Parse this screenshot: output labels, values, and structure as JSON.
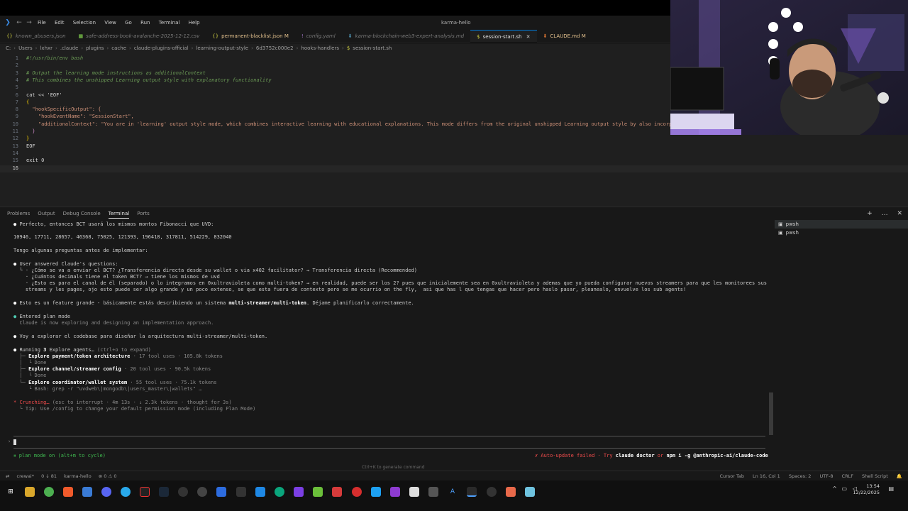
{
  "window": {
    "title": "karma-hello"
  },
  "menu": [
    "File",
    "Edit",
    "Selection",
    "View",
    "Go",
    "Run",
    "Terminal",
    "Help"
  ],
  "tabs": [
    {
      "label": "known_abusers.json",
      "icon": "json-icon",
      "state": "normal"
    },
    {
      "label": "safe-address-book-avalanche-2025-12-12.csv",
      "icon": "csv-icon",
      "state": "normal"
    },
    {
      "label": "permanent-blacklist.json M",
      "icon": "json-icon",
      "state": "modified"
    },
    {
      "label": "config.yaml",
      "icon": "yaml-icon",
      "state": "normal"
    },
    {
      "label": "karma-blockchain-web3-expert-analysis.md",
      "icon": "markdown-icon",
      "state": "normal"
    },
    {
      "label": "session-start.sh",
      "icon": "shell-icon",
      "state": "active"
    },
    {
      "label": "CLAUDE.md M",
      "icon": "markdown-icon",
      "state": "modified"
    }
  ],
  "breadcrumb": [
    "C:",
    "Users",
    "lxhxr",
    ".claude",
    "plugins",
    "cache",
    "claude-plugins-official",
    "learning-output-style",
    "6d3752c000e2",
    "hooks-handlers",
    "session-start.sh"
  ],
  "editor": {
    "lines": [
      {
        "n": "1",
        "text": "#!/usr/bin/env bash"
      },
      {
        "n": "2",
        "text": ""
      },
      {
        "n": "3",
        "text": "# Output the learning mode instructions as additionalContext"
      },
      {
        "n": "4",
        "text": "# This combines the unshipped Learning output style with explanatory functionality"
      },
      {
        "n": "5",
        "text": ""
      },
      {
        "n": "6",
        "text": "cat << 'EOF'"
      },
      {
        "n": "7",
        "text": "{"
      },
      {
        "n": "8",
        "text": "  \"hookSpecificOutput\": {"
      },
      {
        "n": "9",
        "text": "    \"hookEventName\": \"SessionStart\","
      },
      {
        "n": "10",
        "text": "    \"additionalContext\": \"You are in 'learning' output style mode, which combines interactive learning with educational explanations. This mode differs from the original unshipped Learning output style by also incorp"
      },
      {
        "n": "11",
        "text": "  }"
      },
      {
        "n": "12",
        "text": "}"
      },
      {
        "n": "13",
        "text": "EOF"
      },
      {
        "n": "14",
        "text": ""
      },
      {
        "n": "15",
        "text": "exit 0"
      },
      {
        "n": "16",
        "text": ""
      }
    ]
  },
  "panel": {
    "tabs": [
      "Problems",
      "Output",
      "Debug Console",
      "Terminal",
      "Ports"
    ],
    "active_tab": "Terminal",
    "shells": [
      "pwsh",
      "pwsh"
    ]
  },
  "terminal": {
    "l1": "Perfecto, entonces BCT usará los mismos montos Fibonacci que UVD:",
    "l2": "10946, 17711, 28657, 46368, 75025, 121393, 196418, 317811, 514229, 832040",
    "l3": "Tengo algunas preguntas antes de implementar:",
    "l4": "User answered Claude's questions:",
    "l5": "  └ · ¿Cómo se va a enviar el BCT? ¿Transferencia directa desde su wallet o via x402 facilitator? → Transferencia directa (Recommended)",
    "l6": "    · ¿Cuántos decimals tiene el token BCT? → tiene los mismos de uvd",
    "l7": "    · ¿Esto es para el canal de él (separado) o lo integramos en 0xultravioleta como multi-token? → en realidad, puede ser los 2? pues que inicialemente sea en 0xultravioleta y ademas que yo pueda configurar nuevos streamers para que les monitorees sus",
    "l8": "    streams y les pages, ojo esto puede ser algo grande y un poco extenso, se que esta fuera de contexto pero se me ocurrio on the fly,  asi que has l que tengas que hacer pero haslo pasar, pleanealo, envuelve los sub agents!",
    "l9a": "Esto es un feature grande - básicamente estás describiendo un sistema ",
    "l9b": "multi-streamer/multi-token",
    "l9c": ". Déjame planificarlo correctamente.",
    "l10": "Entered plan mode",
    "l11": "Claude is now exploring and designing an implementation approach.",
    "l12": "Voy a explorar el codebase para diseñar la arquitectura multi-streamer/multi-token.",
    "l13a": "Running ",
    "l13b": "3",
    "l13c": " Explore agents… ",
    "l13d": "(ctrl+o to expand)",
    "a1": "Explore payment/token architecture",
    "a1s": " · 17 tool uses · 105.8k tokens",
    "a1d": "Done",
    "a2": "Explore channel/streamer config",
    "a2s": " · 20 tool uses · 90.5k tokens",
    "a2d": "Done",
    "a3": "Explore coordinator/wallet system",
    "a3s": " · 55 tool uses · 75.1k tokens",
    "a3d": "Bash: grep -r \"uvdweb\\|mongodb\\|users_master\\|wallets\" …",
    "s1a": "Crunching… ",
    "s1b": "(esc to interrupt · 4m 13s · ↓ 2.3k tokens · thought for 3s)",
    "s2": "Tip: Use /config to change your default permission mode (including Plan Mode)",
    "mode": "plan mode on (alt+m to cycle)",
    "upd_a": "✗ Auto-update failed · Try ",
    "upd_b": "claude doctor",
    "upd_c": " or ",
    "upd_d": "npm i -g @anthropic-ai/claude-code",
    "hint": "Ctrl+K to generate command"
  },
  "statusbar": {
    "left": [
      "crewai*",
      "0 ↓ 81",
      "karma-hello",
      "⊗ 0 ⚠ 0"
    ],
    "right": [
      "Cursor Tab",
      "Ln 16, Col 1",
      "Spaces: 2",
      "UTF-8",
      "CRLF",
      "Shell Script"
    ]
  },
  "tray": {
    "time": "13:54",
    "date": "12/22/2025"
  },
  "colors": {
    "accent": "#0078d4",
    "editor_bg": "#1f1f1f",
    "panel_bg": "#181818",
    "error": "#f14c4c"
  }
}
